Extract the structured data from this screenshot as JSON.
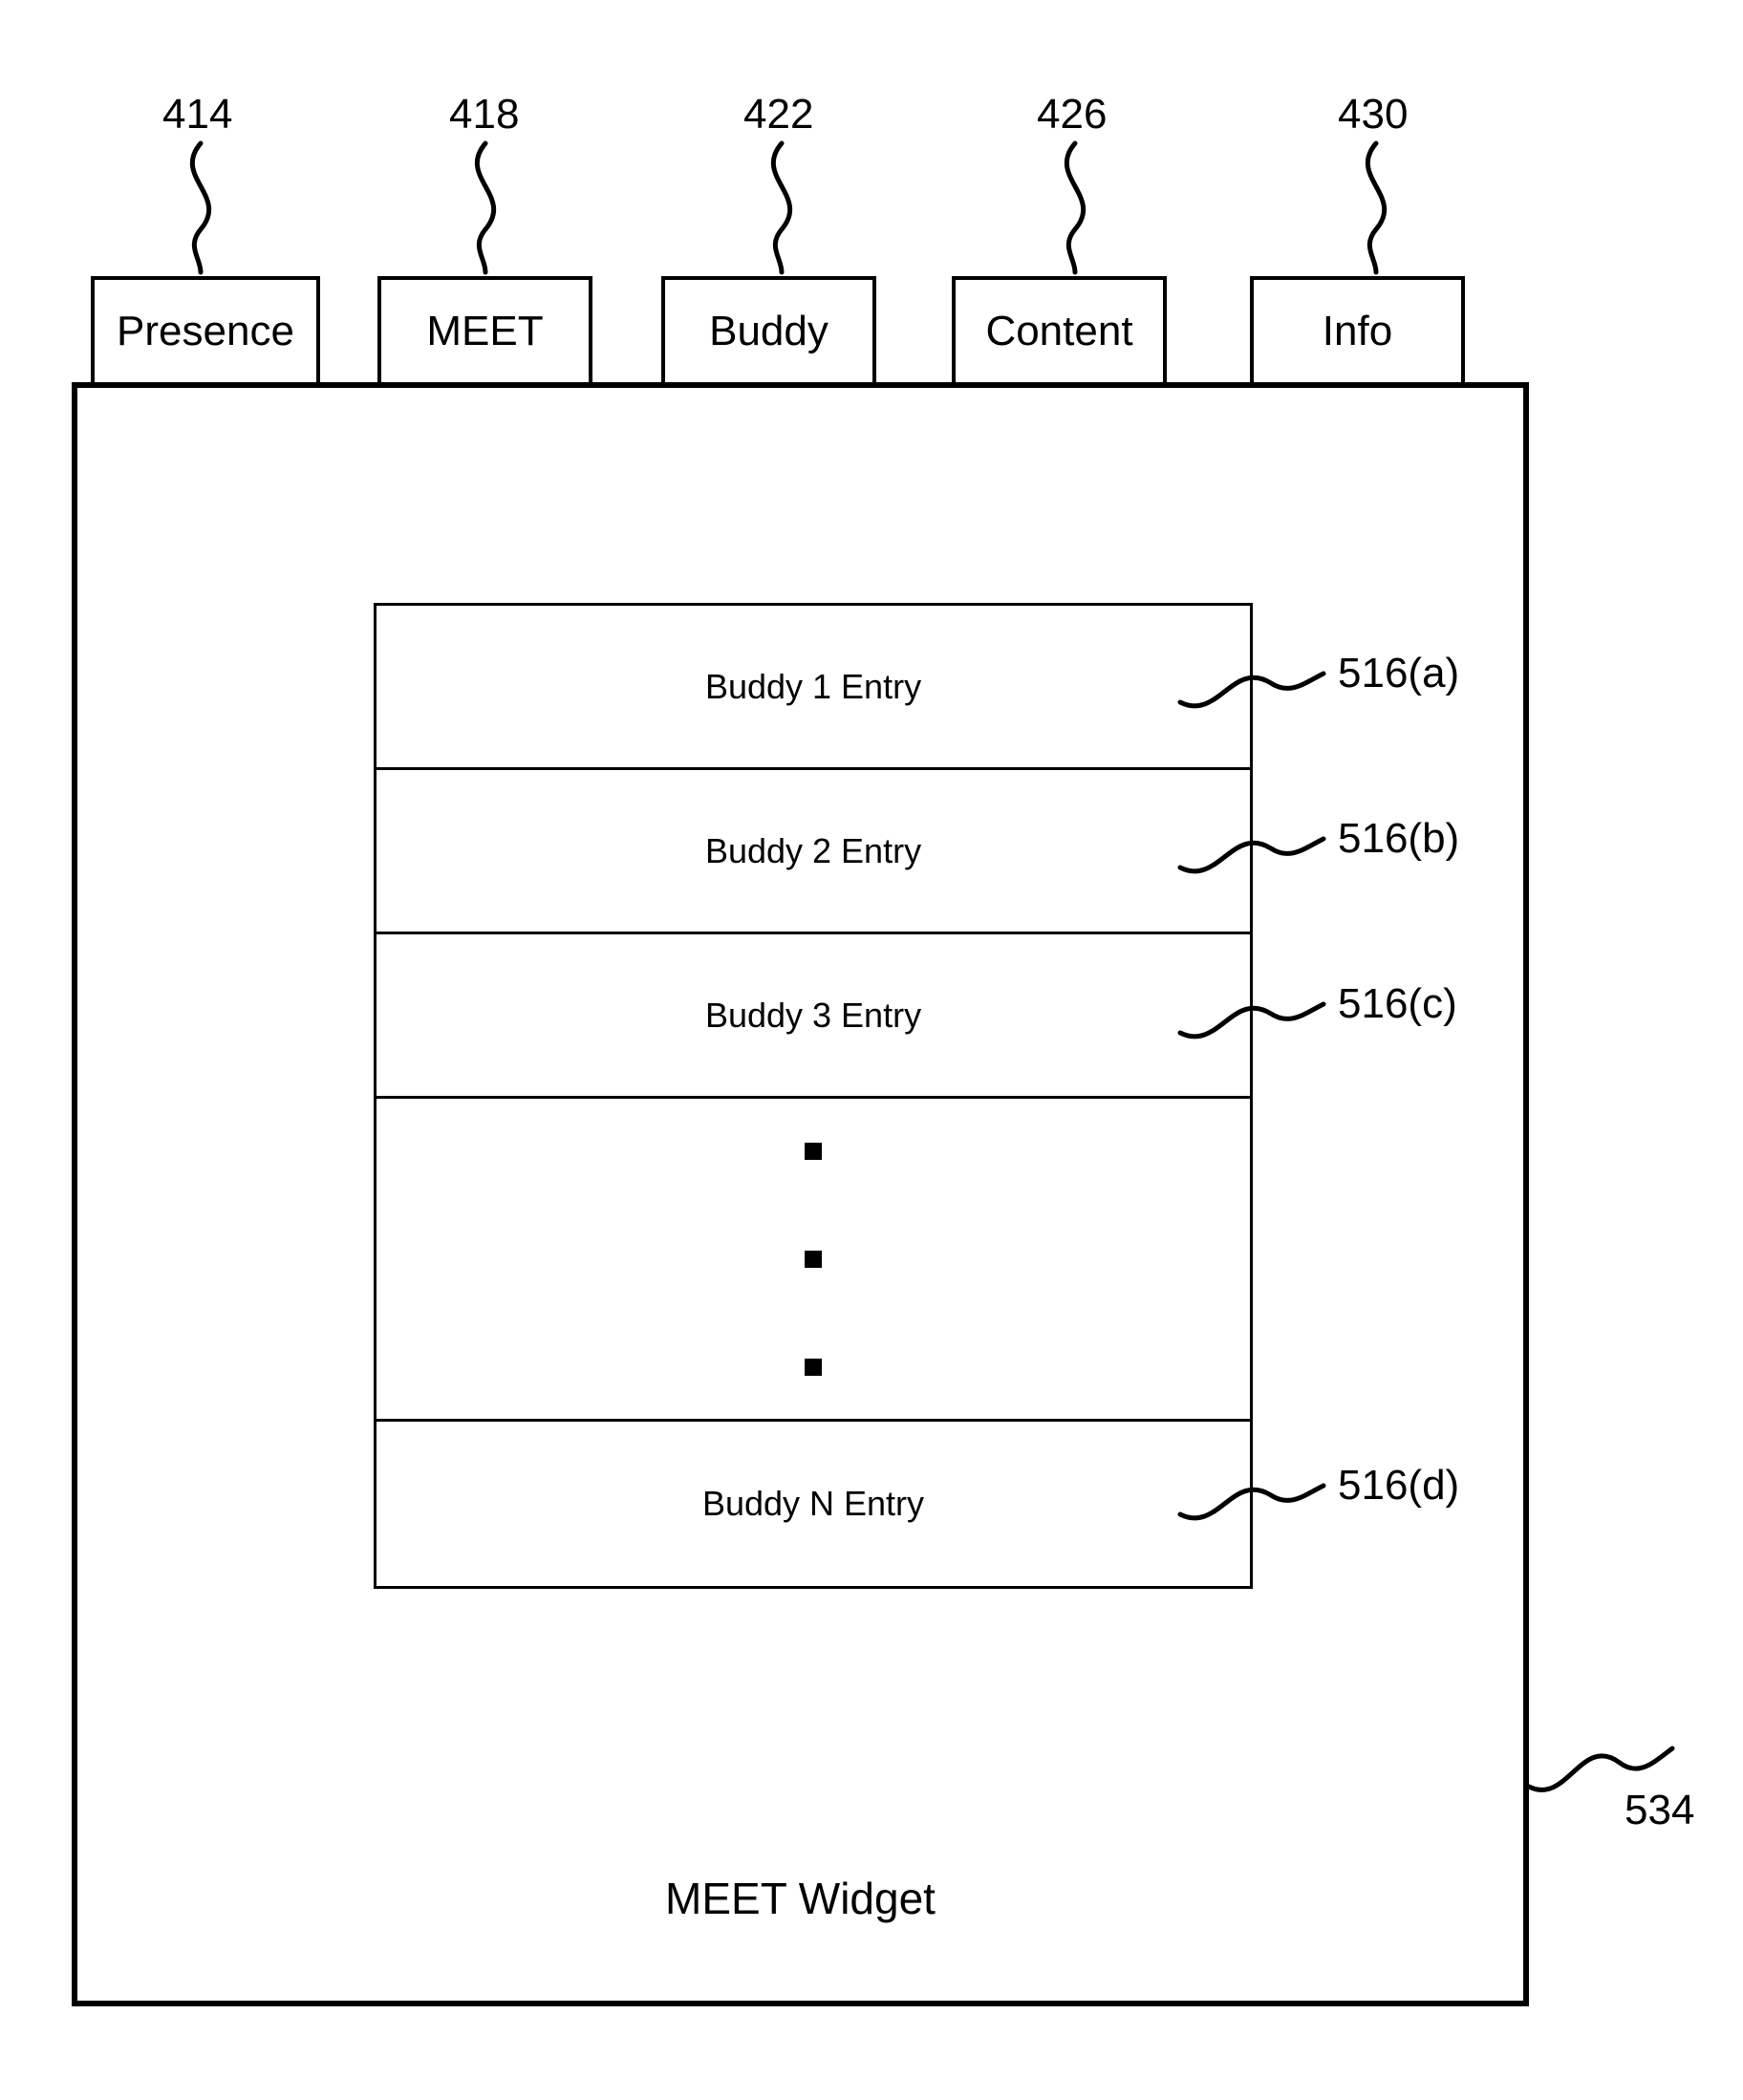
{
  "tabs": [
    {
      "ref": "414",
      "label": "Presence"
    },
    {
      "ref": "418",
      "label": "MEET"
    },
    {
      "ref": "422",
      "label": "Buddy"
    },
    {
      "ref": "426",
      "label": "Content"
    },
    {
      "ref": "430",
      "label": "Info"
    }
  ],
  "widget": {
    "title": "MEET Widget",
    "panel_ref": "534"
  },
  "buddy_entries": [
    {
      "label": "Buddy 1 Entry",
      "ref": "516(a)"
    },
    {
      "label": "Buddy 2 Entry",
      "ref": "516(b)"
    },
    {
      "label": "Buddy 3 Entry",
      "ref": "516(c)"
    },
    {
      "label": "Buddy N Entry",
      "ref": "516(d)"
    }
  ]
}
